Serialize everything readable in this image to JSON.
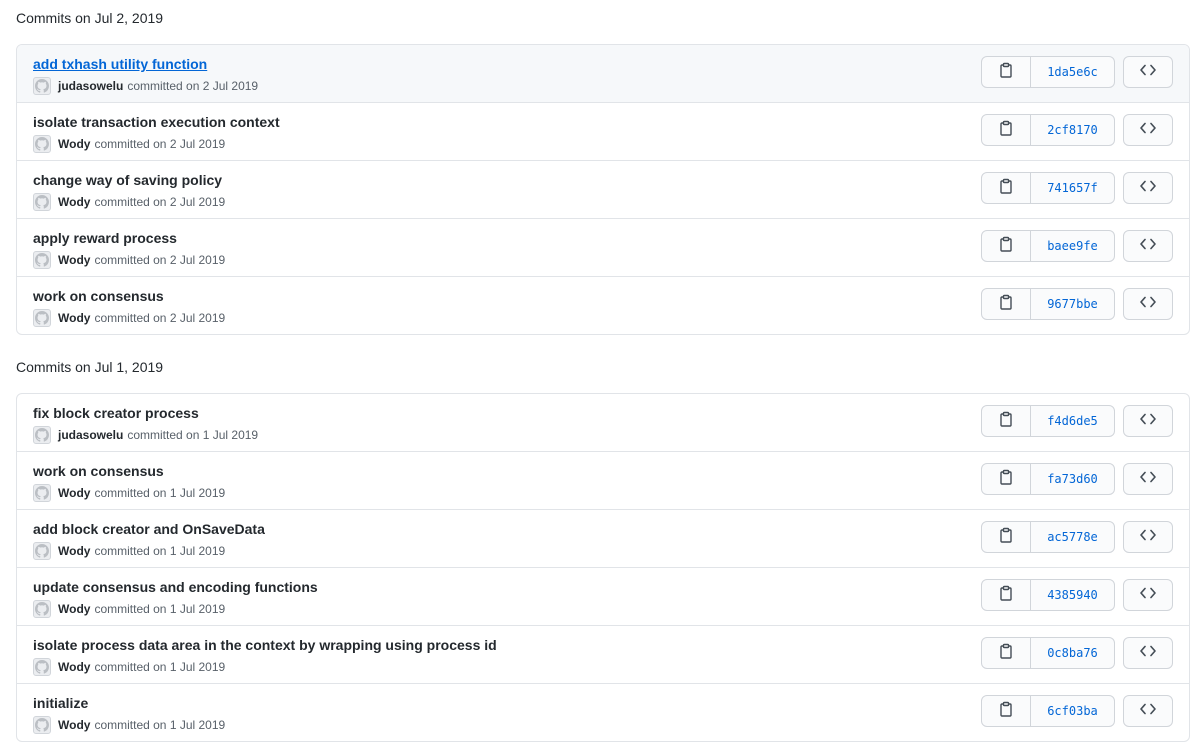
{
  "groups": [
    {
      "title": "Commits on Jul 2, 2019",
      "commits": [
        {
          "message": "add txhash utility function",
          "author": "judasowelu",
          "committed_text": "committed on 2 Jul 2019",
          "sha": "1da5e6c",
          "hovered": true
        },
        {
          "message": "isolate transaction execution context",
          "author": "Wody",
          "committed_text": "committed on 2 Jul 2019",
          "sha": "2cf8170",
          "hovered": false
        },
        {
          "message": "change way of saving policy",
          "author": "Wody",
          "committed_text": "committed on 2 Jul 2019",
          "sha": "741657f",
          "hovered": false
        },
        {
          "message": "apply reward process",
          "author": "Wody",
          "committed_text": "committed on 2 Jul 2019",
          "sha": "baee9fe",
          "hovered": false
        },
        {
          "message": "work on consensus",
          "author": "Wody",
          "committed_text": "committed on 2 Jul 2019",
          "sha": "9677bbe",
          "hovered": false
        }
      ]
    },
    {
      "title": "Commits on Jul 1, 2019",
      "commits": [
        {
          "message": "fix block creator process",
          "author": "judasowelu",
          "committed_text": "committed on 1 Jul 2019",
          "sha": "f4d6de5",
          "hovered": false
        },
        {
          "message": "work on consensus",
          "author": "Wody",
          "committed_text": "committed on 1 Jul 2019",
          "sha": "fa73d60",
          "hovered": false
        },
        {
          "message": "add block creator and OnSaveData",
          "author": "Wody",
          "committed_text": "committed on 1 Jul 2019",
          "sha": "ac5778e",
          "hovered": false
        },
        {
          "message": "update consensus and encoding functions",
          "author": "Wody",
          "committed_text": "committed on 1 Jul 2019",
          "sha": "4385940",
          "hovered": false
        },
        {
          "message": "isolate process data area in the context by wrapping using process id",
          "author": "Wody",
          "committed_text": "committed on 1 Jul 2019",
          "sha": "0c8ba76",
          "hovered": false
        },
        {
          "message": "initialize",
          "author": "Wody",
          "committed_text": "committed on 1 Jul 2019",
          "sha": "6cf03ba",
          "hovered": false
        }
      ]
    }
  ],
  "icons": {
    "copy": "clippy-icon",
    "browse": "code-icon",
    "avatar": "avatar-placeholder-icon"
  },
  "colors": {
    "link": "#0366d6",
    "muted": "#586069",
    "border": "#e1e4e8",
    "hover_bg": "#f6f8fa"
  }
}
